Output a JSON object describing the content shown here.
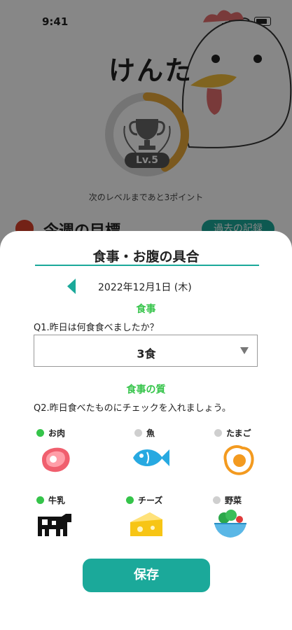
{
  "status_bar": {
    "time": "9:41"
  },
  "profile": {
    "name": "けんた",
    "level_badge": "Lv.5",
    "level_progress": 0.42,
    "next_level_text": "次のレベルまであと3ポイント"
  },
  "goals": {
    "title": "今週の目標",
    "history_button": "過去の記録"
  },
  "sheet": {
    "title": "食事・お腹の具合",
    "date": "2022年12月1日 (木)",
    "meals_heading": "食事",
    "q1": "Q1.昨日は何食食べましたか？",
    "q1_answer": "3食",
    "quality_heading": "食事の質",
    "q2": "Q2.昨日食べたものにチェックを入れましょう。",
    "foods": [
      {
        "label": "お肉",
        "icon": "meat-icon",
        "checked": true
      },
      {
        "label": "魚",
        "icon": "fish-icon",
        "checked": false
      },
      {
        "label": "たまご",
        "icon": "egg-icon",
        "checked": false
      },
      {
        "label": "牛乳",
        "icon": "cow-icon",
        "checked": true
      },
      {
        "label": "チーズ",
        "icon": "cheese-icon",
        "checked": true
      },
      {
        "label": "野菜",
        "icon": "salad-icon",
        "checked": false
      }
    ],
    "save_label": "保存"
  },
  "colors": {
    "accent": "#1ba99a",
    "checked": "#35c44a",
    "unchecked": "#cfcfcf",
    "level_ring": "#e8a93a"
  }
}
